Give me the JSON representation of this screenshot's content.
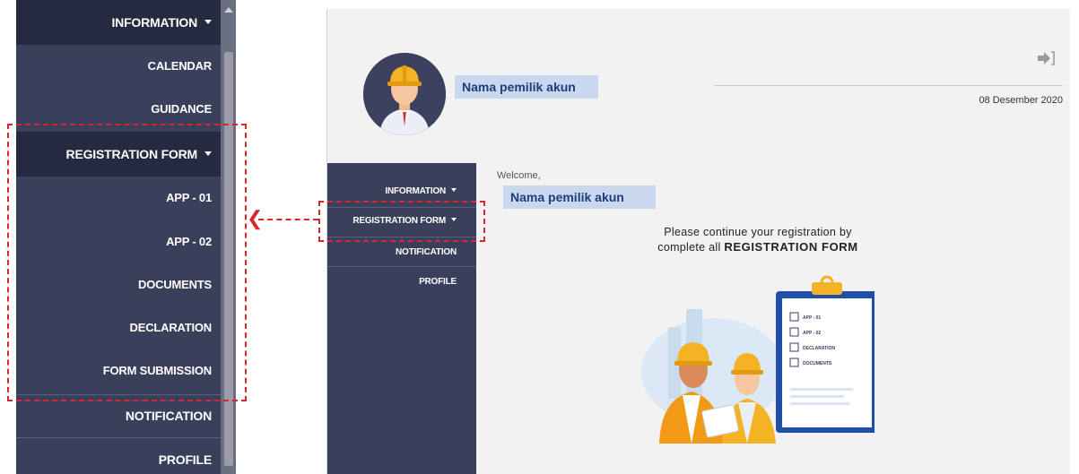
{
  "zoom_sidebar": {
    "information": "INFORMATION",
    "calendar": "CALENDAR",
    "guidance": "GUIDANCE",
    "registration_form": "REGISTRATION FORM",
    "app_01": "APP - 01",
    "app_02": "APP - 02",
    "documents": "DOCUMENTS",
    "declaration": "DECLARATION",
    "form_submission": "FORM SUBMISSION",
    "notification": "NOTIFICATION",
    "profile": "PROFILE"
  },
  "app": {
    "account_name": "Nama pemilik akun",
    "welcome": "Welcome,",
    "welcome_name": "Nama pemilik akun",
    "date": "08 Desember 2020",
    "nav": {
      "information": "INFORMATION",
      "registration_form": "REGISTRATION FORM",
      "notification": "NOTIFICATION",
      "profile": "PROFILE"
    },
    "message_line1": "Please continue your registration by",
    "message_line2_prefix": "complete all ",
    "message_line2_emphasis": "REGISTRATION FORM",
    "checklist": [
      "APP - 01",
      "APP - 02",
      "DECLARATION",
      "DOCUMENTS"
    ]
  },
  "colors": {
    "sidebar_bg": "#3a3f5c",
    "sidebar_active": "#262a40",
    "highlight_dash": "#d9262e",
    "name_tag_bg": "#c9d7ef"
  },
  "icons": [
    "caret-down-icon",
    "logout-icon",
    "avatar-worker-icon",
    "arrow-left-icon"
  ]
}
